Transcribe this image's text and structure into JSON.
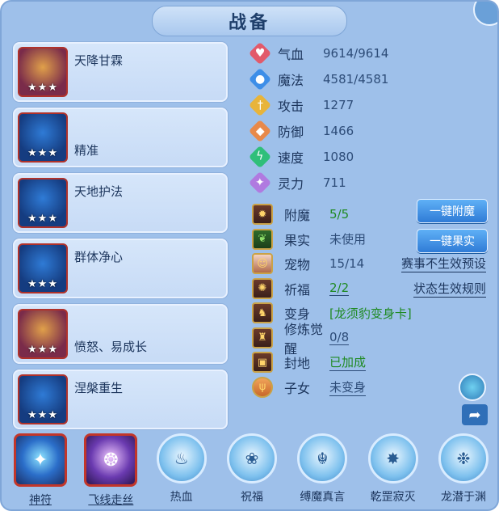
{
  "title": "战备",
  "left_skills": [
    {
      "name": "天降甘霖",
      "stars": "★★★",
      "icon": "skill-rain-icon"
    },
    {
      "name": "精准",
      "stars": "★★★",
      "icon": "skill-precision-icon"
    },
    {
      "name": "天地护法",
      "stars": "★★★",
      "icon": "skill-guardian-icon"
    },
    {
      "name": "群体净心",
      "stars": "★★★",
      "icon": "skill-purify-icon"
    },
    {
      "name": "愤怒、易成长",
      "stars": "★★★",
      "icon": "skill-rage-icon"
    },
    {
      "name": "涅槃重生",
      "stars": "★★★",
      "icon": "skill-rebirth-icon"
    }
  ],
  "stats": [
    {
      "label": "气血",
      "value": "9614/9614",
      "icon": "heart-icon",
      "color": "#e25a6a"
    },
    {
      "label": "魔法",
      "value": "4581/4581",
      "icon": "mana-icon",
      "color": "#3d8ee8"
    },
    {
      "label": "攻击",
      "value": "1277",
      "icon": "sword-icon",
      "color": "#e8b43a"
    },
    {
      "label": "防御",
      "value": "1466",
      "icon": "shield-icon",
      "color": "#e8894a"
    },
    {
      "label": "速度",
      "value": "1080",
      "icon": "lightning-icon",
      "color": "#2fbf7a"
    },
    {
      "label": "灵力",
      "value": "711",
      "icon": "spirit-icon",
      "color": "#b07ae0"
    }
  ],
  "extras": [
    {
      "label": "附魔",
      "value": "5/5",
      "icon": "enchant-icon"
    },
    {
      "label": "果实",
      "value": "未使用",
      "icon": "fruit-icon"
    },
    {
      "label": "宠物",
      "value": "15/14",
      "icon": "pet-icon"
    },
    {
      "label": "祈福",
      "value": "2/2",
      "icon": "pray-icon"
    },
    {
      "label": "变身",
      "value": "[龙须豹变身卡]",
      "icon": "transform-icon"
    },
    {
      "label": "修炼觉醒",
      "value": "0/8",
      "icon": "cultivate-icon"
    },
    {
      "label": "封地",
      "value": "已加成",
      "icon": "fief-icon"
    },
    {
      "label": "子女",
      "value": "未变身",
      "icon": "children-icon"
    }
  ],
  "buttons": {
    "one_key_enchant": "一键附魔",
    "one_key_fruit": "一键果实"
  },
  "links": {
    "event_no_preset": "赛事不生效预设",
    "status_rules": "状态生效规则"
  },
  "bottom_skills": [
    {
      "name": "神符",
      "icon": "talisman-icon"
    },
    {
      "name": "飞线走丝",
      "icon": "thread-icon"
    },
    {
      "name": "热血",
      "icon": "hot-blood-icon"
    },
    {
      "name": "祝福",
      "icon": "blessing-icon"
    },
    {
      "name": "缚魔真言",
      "icon": "bind-demon-icon"
    },
    {
      "name": "乾罡寂灭",
      "icon": "annihilate-icon"
    },
    {
      "name": "龙潜于渊",
      "icon": "dragon-icon"
    }
  ]
}
